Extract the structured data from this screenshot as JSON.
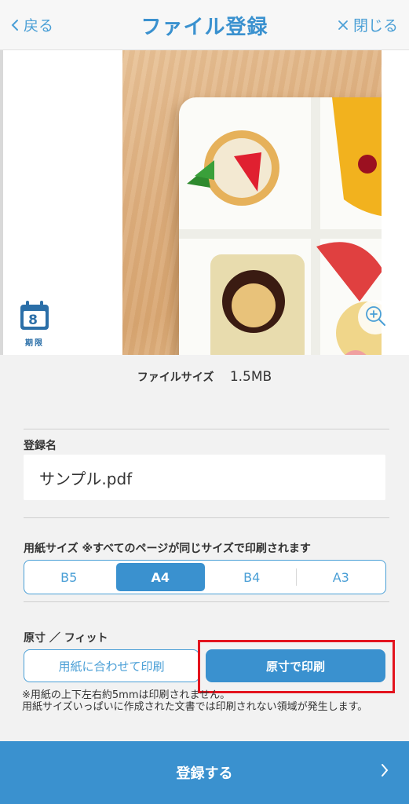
{
  "header": {
    "back_label": "戻る",
    "title": "ファイル登録",
    "close_label": "閉じる"
  },
  "preview": {
    "calendar_day": "8",
    "calendar_label": "期限"
  },
  "file_size": {
    "label": "ファイルサイズ",
    "value": "1.5MB"
  },
  "registration_name": {
    "label": "登録名",
    "value": "サンプル.pdf"
  },
  "paper_size": {
    "label": "用紙サイズ ※すべてのページが同じサイズで印刷されます",
    "options": [
      "B5",
      "A4",
      "B4",
      "A3"
    ],
    "selected": "A4"
  },
  "fit": {
    "label": "原寸 ／ フィット",
    "fit_option": "用紙に合わせて印刷",
    "actual_option": "原寸で印刷",
    "selected": "原寸で印刷"
  },
  "note": {
    "line1": "※用紙の上下左右約5mmは印刷されません。",
    "line2": "用紙サイズいっぱいに作成された文書では印刷されない領域が発生します。"
  },
  "footer": {
    "submit_label": "登録する"
  },
  "colors": {
    "accent": "#3a91cf",
    "accent_light": "#4a9fd6",
    "highlight": "#e3141e"
  }
}
